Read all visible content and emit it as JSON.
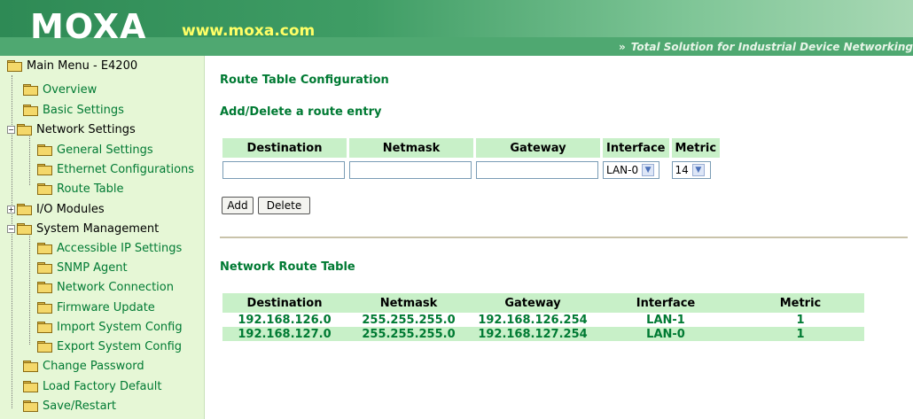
{
  "header": {
    "logo": "MOXA",
    "url": "www.moxa.com",
    "tagline_icon": "double-chevron-right",
    "tagline": "Total Solution for Industrial Device Networking"
  },
  "sidebar": {
    "root": "Main Menu - E4200",
    "items": [
      {
        "label": "Overview"
      },
      {
        "label": "Basic Settings"
      },
      {
        "label": "Network Settings"
      },
      {
        "label": "General Settings"
      },
      {
        "label": "Ethernet Configurations"
      },
      {
        "label": "Route Table"
      },
      {
        "label": "I/O Modules"
      },
      {
        "label": "System Management"
      },
      {
        "label": "Accessible IP Settings"
      },
      {
        "label": "SNMP Agent"
      },
      {
        "label": "Network Connection"
      },
      {
        "label": "Firmware Update"
      },
      {
        "label": "Import System Config"
      },
      {
        "label": "Export System Config"
      },
      {
        "label": "Change Password"
      },
      {
        "label": "Load Factory Default"
      },
      {
        "label": "Save/Restart"
      }
    ]
  },
  "main": {
    "title": "Route Table Configuration",
    "subtitle": "Add/Delete a route entry",
    "form": {
      "headers": [
        "Destination",
        "Netmask",
        "Gateway",
        "Interface",
        "Metric"
      ],
      "destination_value": "",
      "netmask_value": "",
      "gateway_value": "",
      "interface_value": "LAN-0",
      "metric_value": "14"
    },
    "add_label": "Add",
    "delete_label": "Delete",
    "route_table_title": "Network Route Table",
    "route_table": {
      "headers": [
        "Destination",
        "Netmask",
        "Gateway",
        "Interface",
        "Metric"
      ],
      "rows": [
        [
          "192.168.126.0",
          "255.255.255.0",
          "192.168.126.254",
          "LAN-1",
          "1"
        ],
        [
          "192.168.127.0",
          "255.255.255.0",
          "192.168.127.254",
          "LAN-0",
          "1"
        ]
      ]
    }
  },
  "colors": {
    "header_green": "#3f9d65",
    "sidebar_bg": "#e6f7d6",
    "link_green": "#007a33",
    "table_header_bg": "#c8f0c8",
    "url_yellow": "#ffff66"
  }
}
